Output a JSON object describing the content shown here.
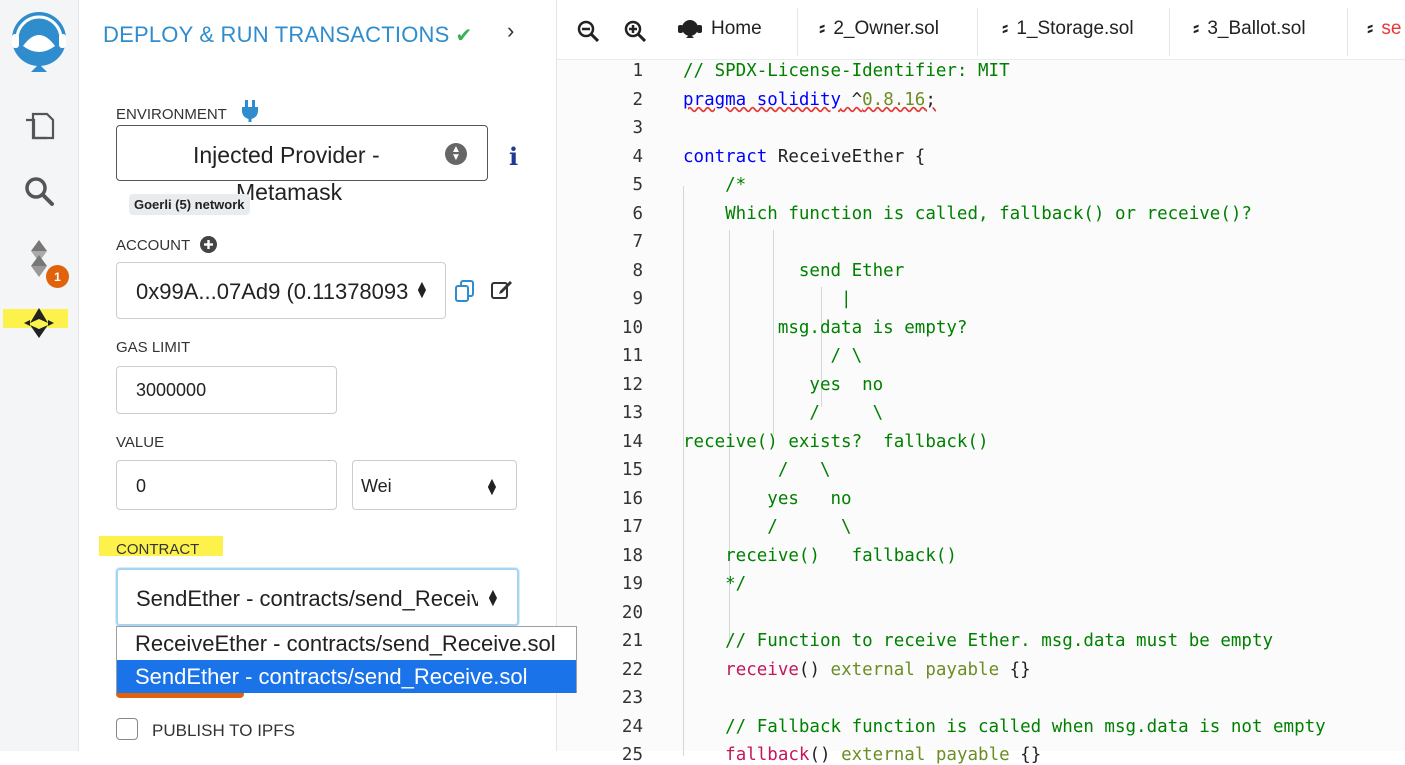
{
  "sidebar_icons": [
    "remix-logo-icon",
    "file-explorer-icon",
    "search-icon",
    "solidity-compiler-icon",
    "deploy-run-icon"
  ],
  "compiler_badge": "1",
  "panel": {
    "title": "DEPLOY & RUN TRANSACTIONS",
    "environment": {
      "label": "ENVIRONMENT",
      "value_line1": "Injected Provider -",
      "value_line2": "Metamask",
      "network": "Goerli (5) network"
    },
    "account": {
      "label": "ACCOUNT",
      "value": "0x99A...07Ad9 (0.11378093"
    },
    "gas_limit": {
      "label": "GAS LIMIT",
      "value": "3000000"
    },
    "value": {
      "label": "VALUE",
      "amount": "0",
      "unit": "Wei"
    },
    "contract": {
      "label": "CONTRACT",
      "selected": "SendEther - contracts/send_Receive.sol",
      "options": [
        "ReceiveEther - contracts/send_Receive.sol",
        "SendEther - contracts/send_Receive.sol"
      ]
    },
    "publish_label": "PUBLISH TO IPFS"
  },
  "tabs": [
    "Home",
    "2_Owner.sol",
    "1_Storage.sol",
    "3_Ballot.sol",
    "se"
  ],
  "colors": {
    "accent": "#2f8ccd",
    "highlight": "#fdf24c",
    "selected_option": "#1a73e8",
    "badge": "#e0620d"
  }
}
